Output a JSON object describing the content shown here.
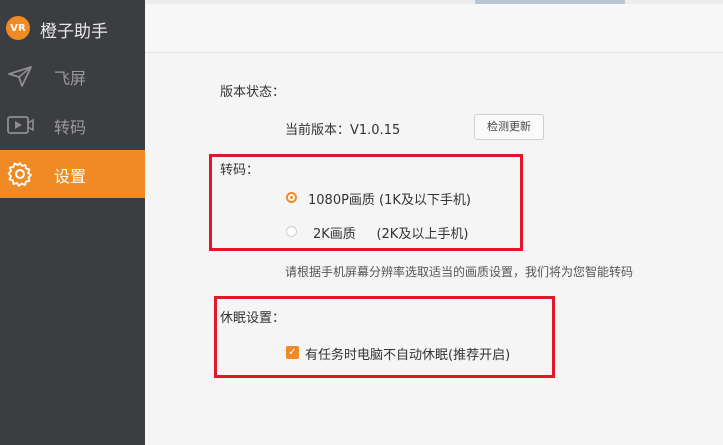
{
  "app": {
    "name": "橙子助手",
    "logo_text": "VR"
  },
  "sidebar": {
    "items": [
      {
        "label": "飞屏",
        "icon": "paper-plane-icon",
        "active": false
      },
      {
        "label": "转码",
        "icon": "video-icon",
        "active": false
      },
      {
        "label": "设置",
        "icon": "gear-icon",
        "active": true
      }
    ]
  },
  "settings": {
    "version": {
      "heading": "版本状态：",
      "current_label": "当前版本：V1.0.15",
      "check_button": "检测更新"
    },
    "transcode": {
      "heading": "转码：",
      "options": [
        {
          "label": "1080P画质 (1K及以下手机)",
          "selected": true
        },
        {
          "label": "2K画质     (2K及以上手机)",
          "selected": false
        }
      ],
      "hint": "请根据手机屏幕分辨率选取适当的画质设置，我们将为您智能转码"
    },
    "sleep": {
      "heading": "休眠设置：",
      "option_label": "有任务时电脑不自动休眠(推荐开启)",
      "checked": true
    }
  },
  "colors": {
    "accent": "#f08a24",
    "sidebar_bg": "#3b3d40",
    "highlight_box": "#e0182a"
  }
}
